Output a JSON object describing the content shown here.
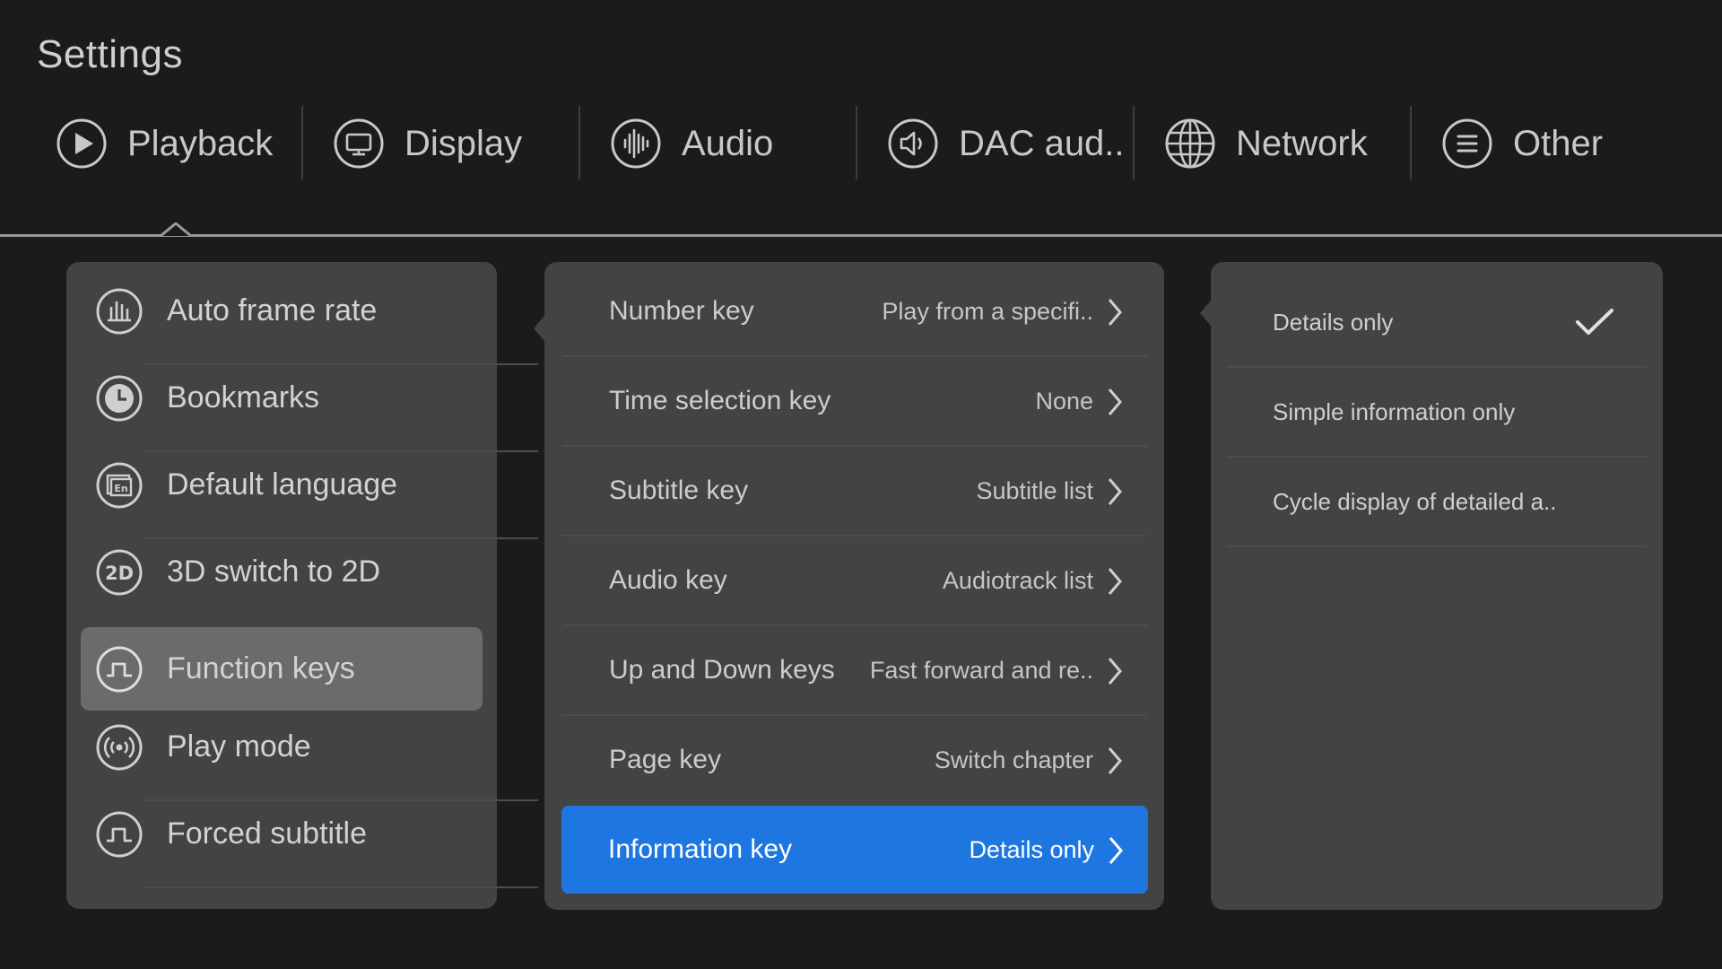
{
  "title": "Settings",
  "tabs": [
    {
      "label": "Playback",
      "icon": "play-circle-icon"
    },
    {
      "label": "Display",
      "icon": "monitor-icon"
    },
    {
      "label": "Audio",
      "icon": "audio-wave-icon"
    },
    {
      "label": "DAC aud..",
      "icon": "speaker-icon"
    },
    {
      "label": "Network",
      "icon": "globe-icon"
    },
    {
      "label": "Other",
      "icon": "menu-icon"
    }
  ],
  "active_tab": "Playback",
  "left_menu": {
    "items": [
      {
        "label": "Auto frame rate",
        "icon": "bar-chart-icon"
      },
      {
        "label": "Bookmarks",
        "icon": "clock-icon"
      },
      {
        "label": "Default language",
        "icon": "language-icon",
        "icon_text": "En"
      },
      {
        "label": "3D switch to 2D",
        "icon": "2d-icon",
        "icon_text": "2D"
      },
      {
        "label": "Function keys",
        "icon": "pulse-icon"
      },
      {
        "label": "Play mode",
        "icon": "broadcast-icon"
      },
      {
        "label": "Forced subtitle",
        "icon": "pulse-icon"
      }
    ],
    "selected": "Function keys"
  },
  "function_keys": {
    "items": [
      {
        "label": "Number key",
        "value": "Play from a specifi.."
      },
      {
        "label": "Time selection key",
        "value": "None"
      },
      {
        "label": "Subtitle key",
        "value": "Subtitle list"
      },
      {
        "label": "Audio key",
        "value": "Audiotrack list"
      },
      {
        "label": "Up and Down keys",
        "value": "Fast forward and re.."
      },
      {
        "label": "Page key",
        "value": "Switch chapter"
      },
      {
        "label": "Information key",
        "value": "Details only"
      }
    ],
    "selected": "Information key"
  },
  "options": {
    "items": [
      {
        "label": "Details only"
      },
      {
        "label": "Simple information only"
      },
      {
        "label": "Cycle display of detailed a.."
      }
    ],
    "checked": "Details only"
  },
  "colors": {
    "background": "#1b1b1b",
    "panel": "#434343",
    "selected_left": "#6b6b6b",
    "accent_blue": "#1e77e0"
  }
}
